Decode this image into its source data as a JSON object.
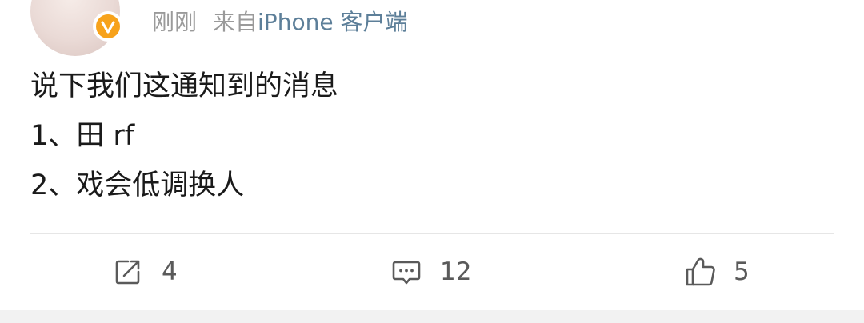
{
  "post": {
    "meta": {
      "time": "刚刚",
      "source_prefix": "来自",
      "source": "iPhone 客户端"
    },
    "lines": [
      "说下我们这通知到的消息",
      "1、田 rf",
      "2、戏会低调换人"
    ]
  },
  "actions": {
    "repost": {
      "icon": "repost-icon",
      "count": "4"
    },
    "comment": {
      "icon": "comment-icon",
      "count": "12"
    },
    "like": {
      "icon": "thumbs-up-icon",
      "count": "5"
    }
  },
  "colors": {
    "badge": "#f7a21b",
    "source_link": "#5d7f99",
    "meta_text": "#9a9a9a"
  }
}
